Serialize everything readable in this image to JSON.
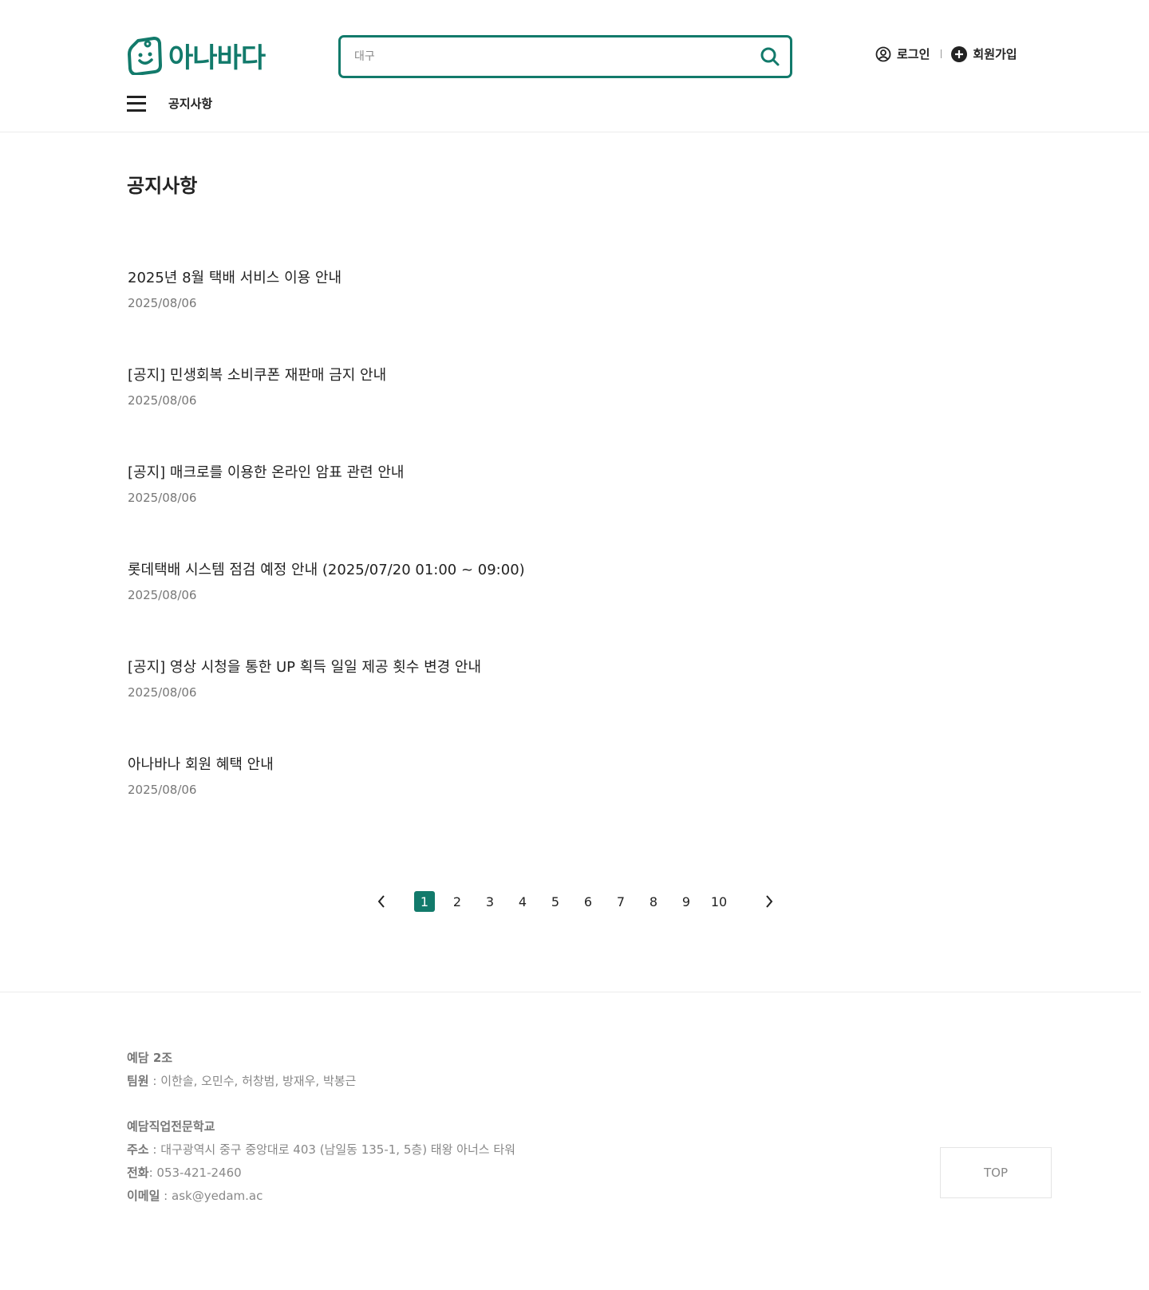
{
  "header": {
    "logo_text": "아나바다",
    "search": {
      "placeholder": "대구",
      "value": ""
    },
    "auth": {
      "login": "로그인",
      "signup": "회원가입"
    },
    "nav": {
      "link": "공지사항"
    }
  },
  "main": {
    "title": "공지사항",
    "notices": [
      {
        "title": "2025년 8월 택배 서비스 이용 안내",
        "date": "2025/08/06"
      },
      {
        "title": "[공지] 민생회복 소비쿠폰 재판매 금지 안내",
        "date": "2025/08/06"
      },
      {
        "title": "[공지] 매크로를 이용한 온라인 암표 관련 안내",
        "date": "2025/08/06"
      },
      {
        "title": "롯데택배 시스템 점검 예정 안내 (2025/07/20 01:00 ~ 09:00)",
        "date": "2025/08/06"
      },
      {
        "title": "[공지] 영상 시청을 통한 UP 획득 일일 제공 횟수 변경 안내",
        "date": "2025/08/06"
      },
      {
        "title": "아나바나 회원 혜택 안내",
        "date": "2025/08/06"
      }
    ],
    "pagination": {
      "pages": [
        "1",
        "2",
        "3",
        "4",
        "5",
        "6",
        "7",
        "8",
        "9",
        "10"
      ],
      "current": "1"
    }
  },
  "footer": {
    "team_name": "예담 2조",
    "members_label": "팀원",
    "members": " : 이한솔, 오민수, 허창범, 방재우, 박봉근",
    "school": "예담직업전문학교",
    "address_label": "주소",
    "address": " : 대구광역시 중구 중앙대로 403 (남일동 135-1, 5층) 태왕 아너스 타워",
    "phone_label": "전화",
    "phone": ": 053-421-2460",
    "email_label": "이메일",
    "email": " : ask@yedam.ac",
    "top_button": "TOP"
  },
  "colors": {
    "accent": "#127a6b",
    "text": "#222222",
    "muted": "#777777"
  },
  "icons": [
    "logo-face-icon",
    "search-icon",
    "user-circle-icon",
    "plus-circle-icon",
    "hamburger-icon",
    "chevron-left-icon",
    "chevron-right-icon"
  ]
}
